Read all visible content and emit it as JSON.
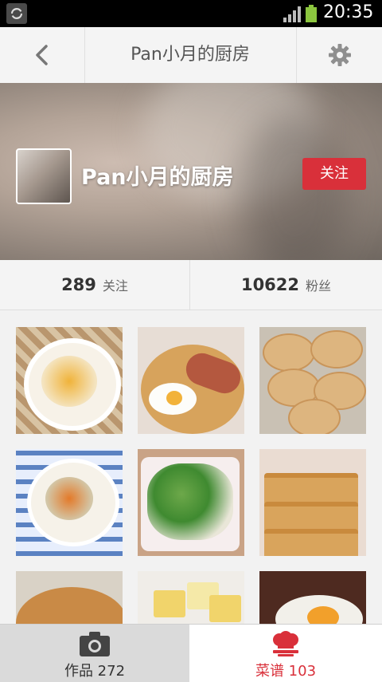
{
  "status_bar": {
    "time": "20:35"
  },
  "header": {
    "title": "Pan小月的厨房"
  },
  "profile": {
    "name": "Pan小月的厨房",
    "follow_label": "关注"
  },
  "stats": {
    "following_count": "289",
    "following_label": "关注",
    "fans_count": "10622",
    "fans_label": "粉丝"
  },
  "tabs": {
    "works_label": "作品 272",
    "recipes_label": "菜谱 103",
    "active": "recipes"
  },
  "colors": {
    "accent": "#d9303a",
    "header_bg": "#f4f4f4"
  },
  "icons": [
    "sync-icon",
    "signal-icon",
    "battery-icon",
    "back-icon",
    "gear-icon",
    "camera-icon",
    "chef-hat-icon"
  ]
}
